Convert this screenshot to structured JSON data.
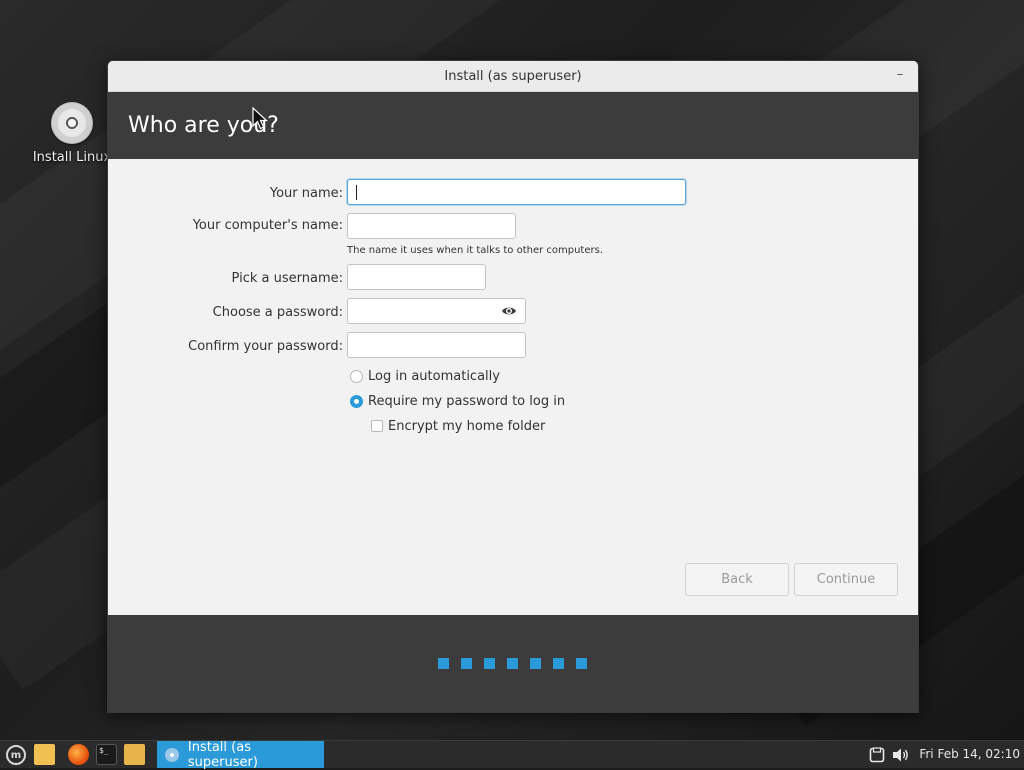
{
  "desktop": {
    "install_icon_label": "Install Linux"
  },
  "window": {
    "title": "Install (as superuser)",
    "minimize_glyph": "–",
    "header_title": "Who are you?",
    "form": {
      "your_name_label": "Your name:",
      "your_name_value": "",
      "computer_name_label": "Your computer's name:",
      "computer_name_value": "",
      "computer_name_hint": "The name it uses when it talks to other computers.",
      "username_label": "Pick a username:",
      "username_value": "",
      "password_label": "Choose a password:",
      "password_value": "",
      "confirm_password_label": "Confirm your password:",
      "confirm_password_value": ""
    },
    "options": {
      "login_auto_label": "Log in automatically",
      "login_auto_selected": false,
      "require_password_label": "Require my password to log in",
      "require_password_selected": true,
      "encrypt_home_label": "Encrypt my home folder",
      "encrypt_home_checked": false
    },
    "buttons": {
      "back_label": "Back",
      "continue_label": "Continue"
    },
    "progress": {
      "step_count": 7,
      "accent": "#2a9ad8"
    }
  },
  "taskbar": {
    "menu_icon": "mint-logo-icon",
    "terminal_glyph": "$_",
    "active_task_label": "Install (as superuser)",
    "clock": "Fri Feb 14, 02:10",
    "accent": "#2a9ad8"
  }
}
